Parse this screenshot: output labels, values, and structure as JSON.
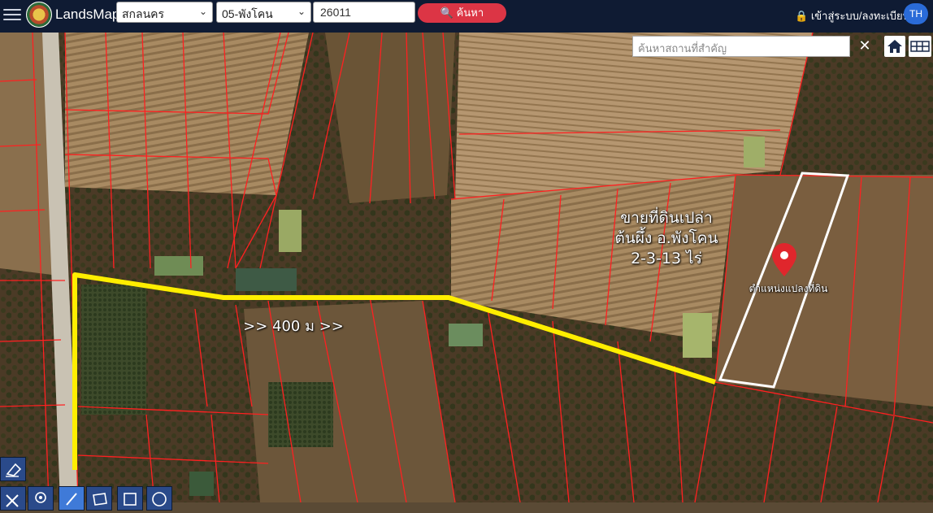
{
  "header": {
    "brand": "LandsMaps",
    "province": "สกลนคร",
    "district": "05-พังโคน",
    "parcel_number": "26011",
    "search_label": "ค้นหา",
    "login_label": "เข้าสู่ระบบ/ลงทะเบียน",
    "lang": "TH"
  },
  "map": {
    "place_search_placeholder": "ค้นหาสถานที่สำคัญ",
    "distance_label": ">>  400 ม  >>",
    "listing_line1": "ขายที่ดินเปล่า",
    "listing_line2": "ต้นผึ้ง อ.พังโคน",
    "listing_line3": "2-3-13 ไร่",
    "marker_label": "ตำแหน่งแปลงที่ดิน",
    "colors": {
      "route": "#ffee00",
      "parcel_lines": "#ff2020",
      "header": "#0f1b33",
      "search_button": "#dc3545"
    }
  }
}
